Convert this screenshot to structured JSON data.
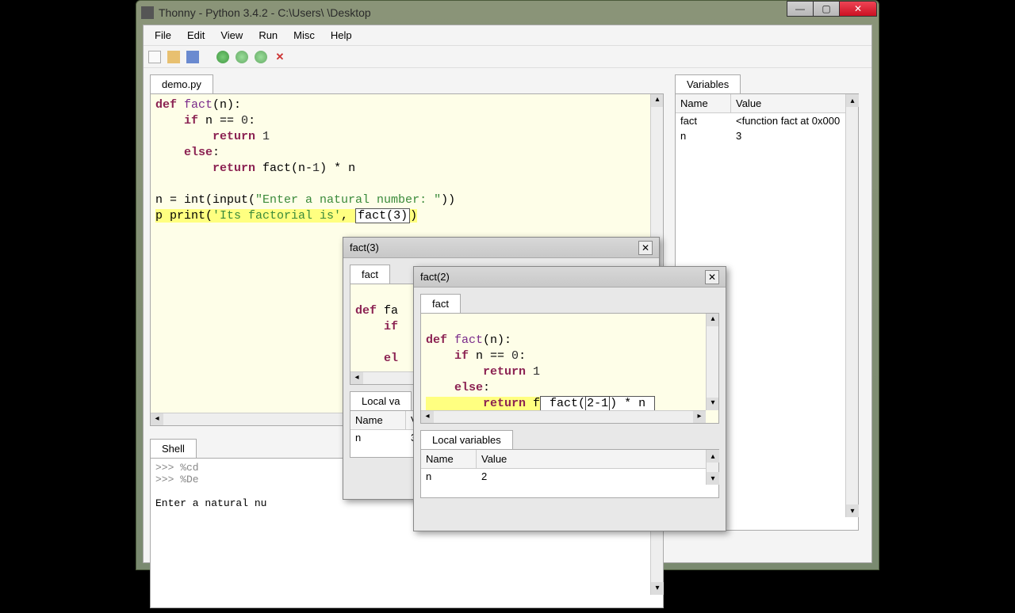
{
  "window": {
    "title": "Thonny  -  Python 3.4.2  -  C:\\Users\\    \\Desktop"
  },
  "menu": [
    "File",
    "Edit",
    "View",
    "Run",
    "Misc",
    "Help"
  ],
  "toolbar_icons": [
    "new-file-icon",
    "open-file-icon",
    "save-icon",
    "run-icon",
    "debug-icon",
    "step-icon",
    "stop-icon"
  ],
  "editor": {
    "tab": "demo.py",
    "code_line1": "def fact(n):",
    "code_line2": "    if n == 0:",
    "code_line3": "        return 1",
    "code_line4": "    else:",
    "code_line5": "        return fact(n-1) * n",
    "code_line6": "",
    "code_line7": "n = int(input(\"Enter a natural number: \"))",
    "code_line8_pre": "p print(",
    "code_line8_str": "'Its factorial is'",
    "code_line8_mid": ", ",
    "code_line8_call": "fact(3)",
    "code_line8_post": ")"
  },
  "variables": {
    "panel_title": "Variables",
    "col1": "Name",
    "col2": "Value",
    "rows": [
      {
        "name": "fact",
        "value": "<function fact at 0x000"
      },
      {
        "name": "n",
        "value": "3"
      }
    ]
  },
  "shell": {
    "panel_title": "Shell",
    "lines": [
      ">>> %cd",
      ">>> %De",
      "",
      "Enter a natural nu"
    ]
  },
  "dbg3": {
    "title": "fact(3)",
    "tab": "fact",
    "l1": "def fa",
    "l2": "    if",
    "l3": "      ",
    "l4": "    el",
    "lv_title": "Local va",
    "col1": "Name",
    "col2": "Va",
    "row_name": "n",
    "row_val": "3"
  },
  "dbg2": {
    "title": "fact(2)",
    "tab": "fact",
    "l1": "def fact(n):",
    "l2": "    if n == 0:",
    "l3": "        return 1",
    "l4": "    else:",
    "l5_pre": "        return f",
    "l5_call_pre": " fact(",
    "l5_hl": "2-1",
    "l5_call_post": ") * n ",
    "lv_title": "Local variables",
    "col1": "Name",
    "col2": "Value",
    "row_name": "n",
    "row_val": "2"
  }
}
